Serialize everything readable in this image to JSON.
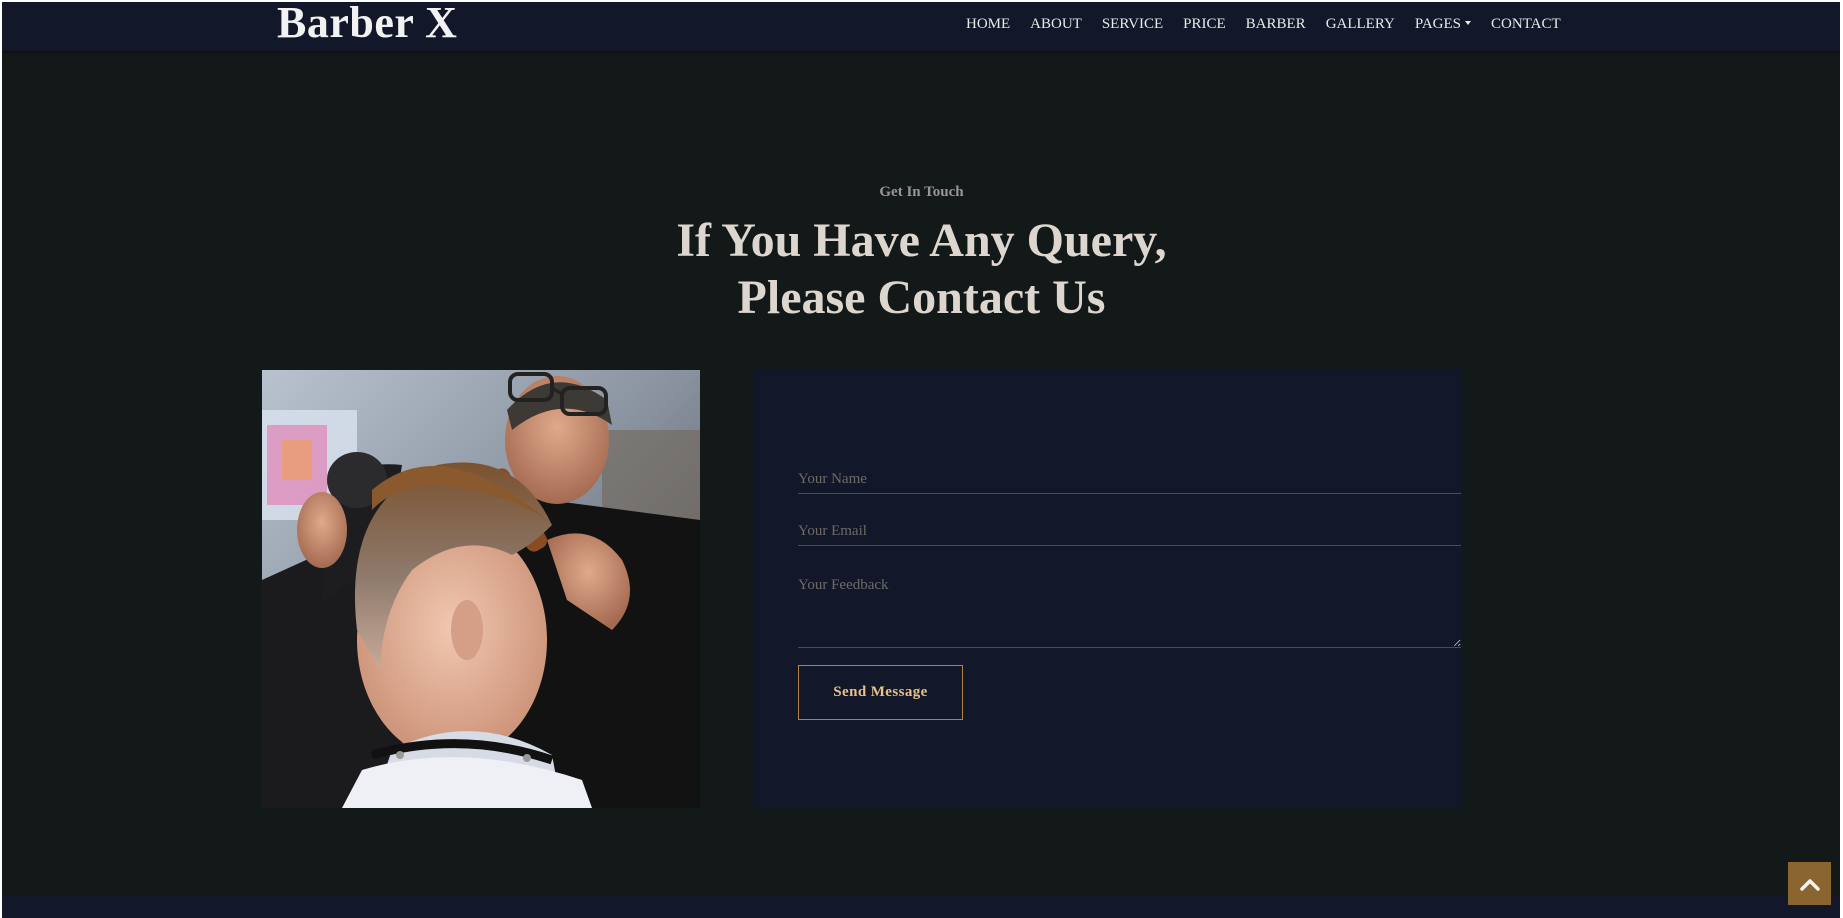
{
  "brand": {
    "name": "Barber X"
  },
  "nav": {
    "items": [
      {
        "label": "HOME"
      },
      {
        "label": "ABOUT"
      },
      {
        "label": "SERVICE"
      },
      {
        "label": "PRICE"
      },
      {
        "label": "BARBER"
      },
      {
        "label": "GALLERY"
      },
      {
        "label": "PAGES"
      },
      {
        "label": "CONTACT"
      }
    ]
  },
  "contact": {
    "eyebrow": "Get In Touch",
    "title_line1": "If You Have Any Query,",
    "title_line2": "Please Contact Us",
    "form": {
      "name_placeholder": "Your Name",
      "email_placeholder": "Your Email",
      "feedback_placeholder": "Your Feedback",
      "send_label": "Send Message"
    }
  },
  "icons": {
    "dropdown": "caret-down-icon",
    "back_to_top": "chevron-up-icon"
  },
  "colors": {
    "background": "#131818",
    "navbar": "#121829",
    "accent": "#8a6530",
    "button_border": "#b38143"
  }
}
